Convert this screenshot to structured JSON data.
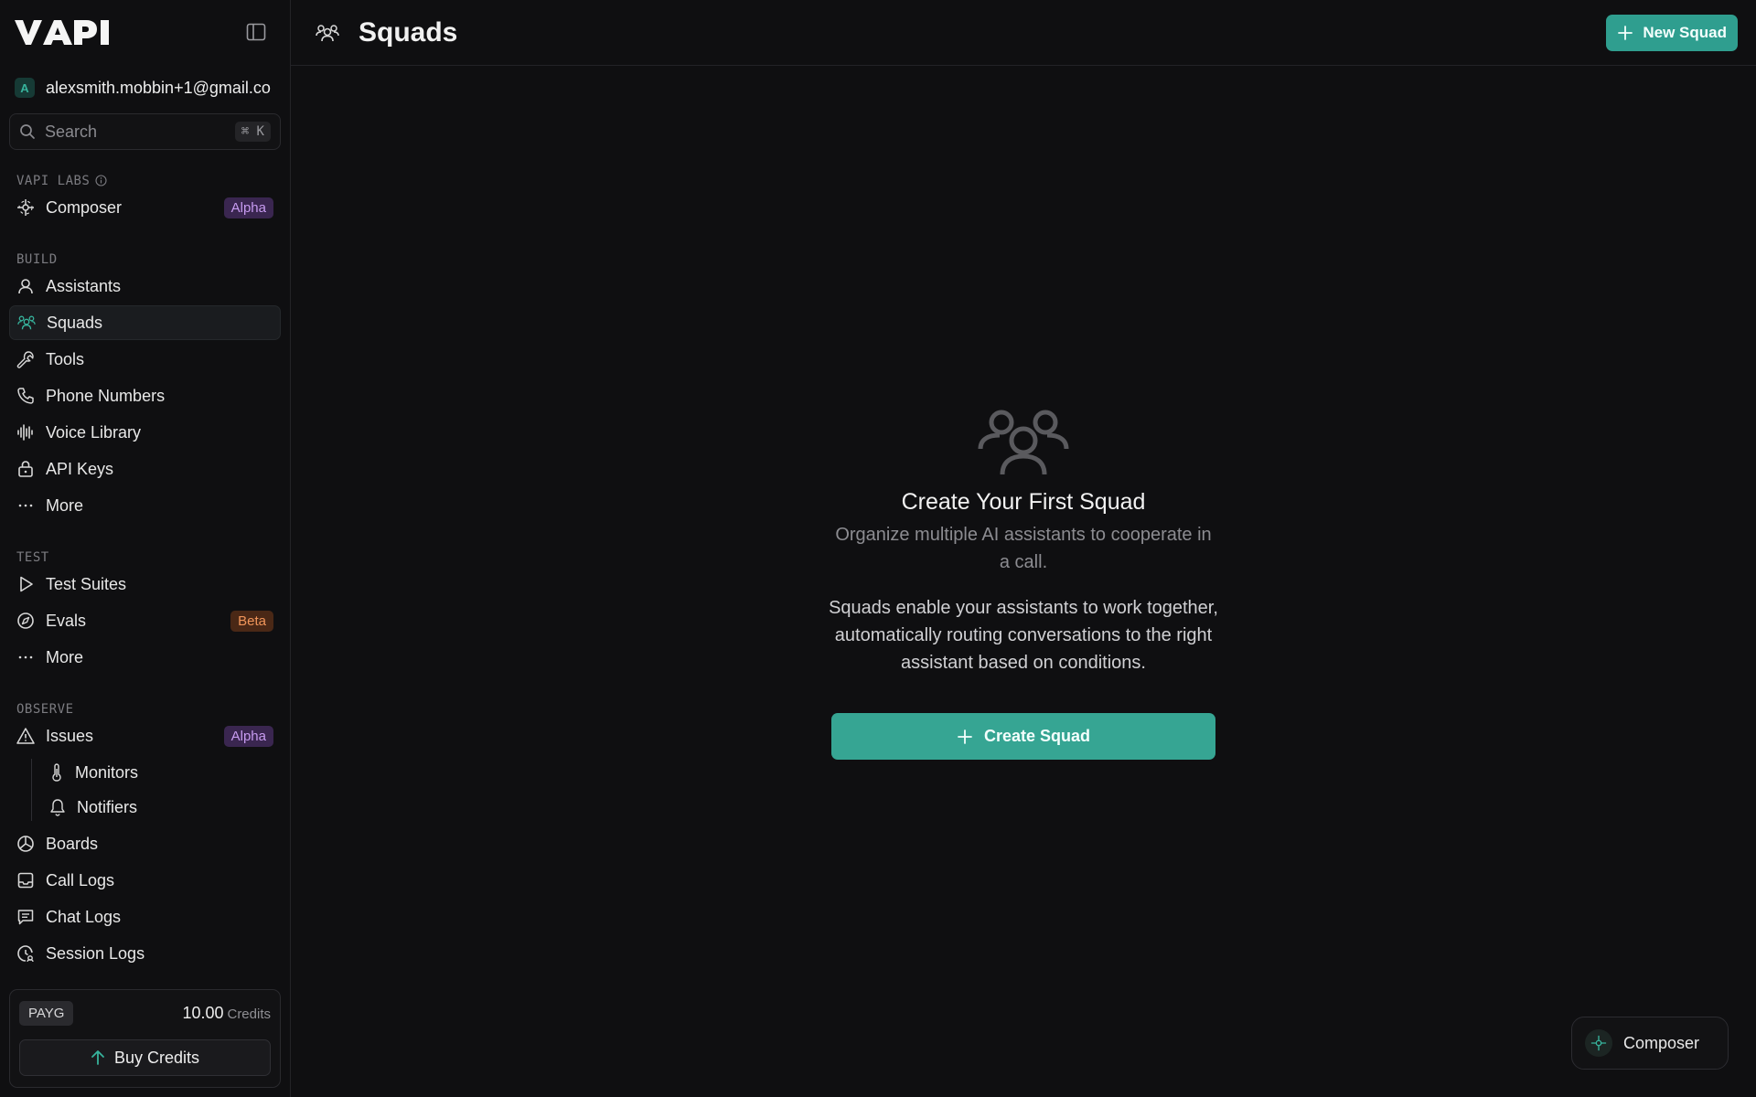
{
  "brand": {
    "logo_text": "VAPI",
    "accent": "#2f9e8f"
  },
  "account": {
    "initial": "A",
    "email": "alexsmith.mobbin+1@gmail.co"
  },
  "search": {
    "placeholder": "Search",
    "shortcut": "⌘ K"
  },
  "sections": {
    "labs": {
      "label": "VAPI LABS",
      "items": [
        {
          "label": "Composer",
          "icon": "composer-icon",
          "badge": "Alpha"
        }
      ]
    },
    "build": {
      "label": "BUILD",
      "items": [
        {
          "label": "Assistants",
          "icon": "user-icon"
        },
        {
          "label": "Squads",
          "icon": "users-icon",
          "active": true
        },
        {
          "label": "Tools",
          "icon": "wrench-icon"
        },
        {
          "label": "Phone Numbers",
          "icon": "phone-icon"
        },
        {
          "label": "Voice Library",
          "icon": "audio-wave-icon"
        },
        {
          "label": "API Keys",
          "icon": "lock-icon"
        },
        {
          "label": "More",
          "icon": "more-icon"
        }
      ]
    },
    "test": {
      "label": "TEST",
      "items": [
        {
          "label": "Test Suites",
          "icon": "play-icon"
        },
        {
          "label": "Evals",
          "icon": "compass-icon",
          "badge": "Beta"
        },
        {
          "label": "More",
          "icon": "more-icon"
        }
      ]
    },
    "observe": {
      "label": "OBSERVE",
      "items": [
        {
          "label": "Issues",
          "icon": "warning-icon",
          "badge": "Alpha"
        },
        {
          "label": "Monitors",
          "icon": "thermometer-icon"
        },
        {
          "label": "Notifiers",
          "icon": "bell-icon"
        },
        {
          "label": "Boards",
          "icon": "pie-chart-icon"
        },
        {
          "label": "Call Logs",
          "icon": "inbox-icon"
        },
        {
          "label": "Chat Logs",
          "icon": "message-icon"
        },
        {
          "label": "Session Logs",
          "icon": "session-icon"
        }
      ]
    }
  },
  "credits": {
    "plan": "PAYG",
    "amount": "10.00",
    "unit": "Credits",
    "buy_label": "Buy Credits"
  },
  "header": {
    "title": "Squads",
    "new_button": "New Squad"
  },
  "empty_state": {
    "title": "Create Your First Squad",
    "subtitle": "Organize multiple AI assistants to cooperate in a call.",
    "description": "Squads enable your assistants to work together, automatically routing conversations to the right assistant based on conditions.",
    "button": "Create Squad"
  },
  "composer_fab": {
    "label": "Composer"
  }
}
